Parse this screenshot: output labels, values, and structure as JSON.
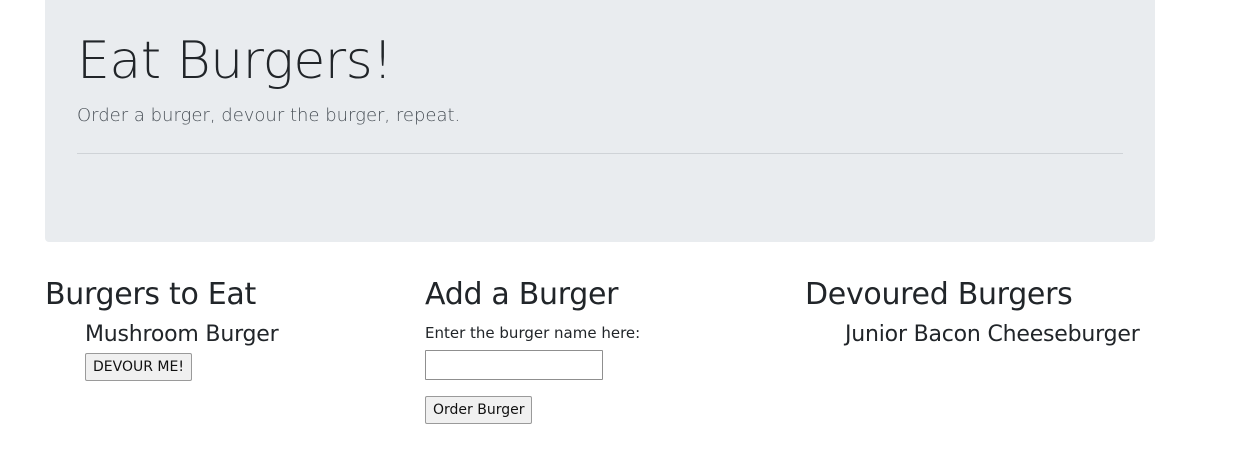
{
  "jumbotron": {
    "title": "Eat Burgers!",
    "subtitle": "Order a burger, devour the burger, repeat."
  },
  "to_eat": {
    "heading": "Burgers to Eat",
    "items": [
      {
        "name": "Mushroom Burger",
        "button_label": "DEVOUR ME!"
      }
    ]
  },
  "add_burger": {
    "heading": "Add a Burger",
    "label": "Enter the burger name here:",
    "input_value": "",
    "button_label": "Order Burger"
  },
  "devoured": {
    "heading": "Devoured Burgers",
    "items": [
      {
        "name": "Junior Bacon Cheeseburger"
      }
    ]
  },
  "colors": {
    "jumbotron_bg": "#e9ecef",
    "text": "#212529",
    "button_bg": "#f0f0f0"
  }
}
